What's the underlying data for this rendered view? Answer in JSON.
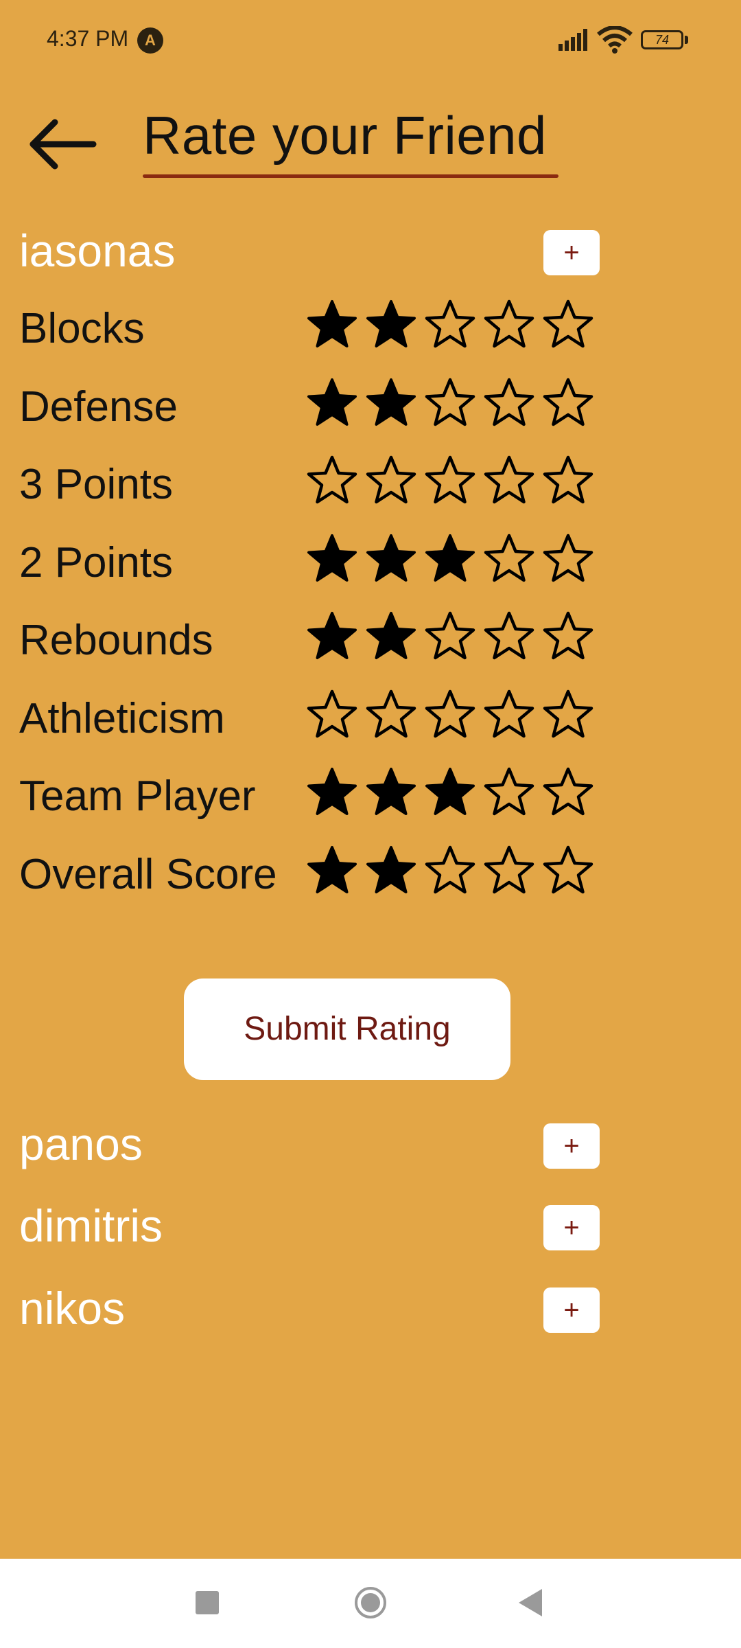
{
  "status_bar": {
    "time": "4:37 PM",
    "app_icon": "A",
    "battery": "74"
  },
  "header": {
    "title": "Rate your Friend",
    "back_icon": "arrow-left"
  },
  "friends": [
    {
      "name": "iasonas",
      "toggle": "+"
    },
    {
      "name": "panos",
      "toggle": "+"
    },
    {
      "name": "dimitris",
      "toggle": "+"
    },
    {
      "name": "nikos",
      "toggle": "+"
    }
  ],
  "ratings": [
    {
      "label": "Blocks",
      "value": 2,
      "max": 5
    },
    {
      "label": "Defense",
      "value": 2,
      "max": 5
    },
    {
      "label": "3 Points",
      "value": 0,
      "max": 5
    },
    {
      "label": "2 Points",
      "value": 3,
      "max": 5
    },
    {
      "label": "Rebounds",
      "value": 2,
      "max": 5
    },
    {
      "label": "Athleticism",
      "value": 0,
      "max": 5
    },
    {
      "label": "Team Player",
      "value": 3,
      "max": 5
    },
    {
      "label": "Overall Score",
      "value": 2,
      "max": 5
    }
  ],
  "submit_label": "Submit Rating",
  "colors": {
    "background": "#E3A646",
    "accent": "#8A2A10",
    "button_text": "#6e1a12"
  }
}
